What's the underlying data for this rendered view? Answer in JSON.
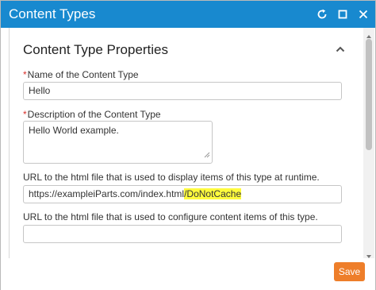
{
  "dialog": {
    "title": "Content Types"
  },
  "section": {
    "title": "Content Type Properties"
  },
  "fields": {
    "name": {
      "required_mark": "*",
      "label": "Name of the Content Type",
      "value": "Hello"
    },
    "description": {
      "required_mark": "*",
      "label": "Description of the Content Type",
      "value": "Hello World example."
    },
    "display_url": {
      "label": "URL to the html file that is used to display items of this type at runtime.",
      "value_prefix": "https://exampleiParts.com/index.html",
      "value_highlight": "/DoNotCache"
    },
    "configure_url": {
      "label": "URL to the html file that is used to configure content items of this type.",
      "value": ""
    }
  },
  "footer": {
    "save_label": "Save"
  },
  "colors": {
    "titlebar": "#1889cf",
    "save_button": "#ee7e2a",
    "highlight": "#fffb3d",
    "required": "#d9302b"
  },
  "icons": {
    "refresh": "refresh-icon",
    "maximize": "maximize-icon",
    "close": "close-icon",
    "collapse": "chevron-up-icon"
  }
}
